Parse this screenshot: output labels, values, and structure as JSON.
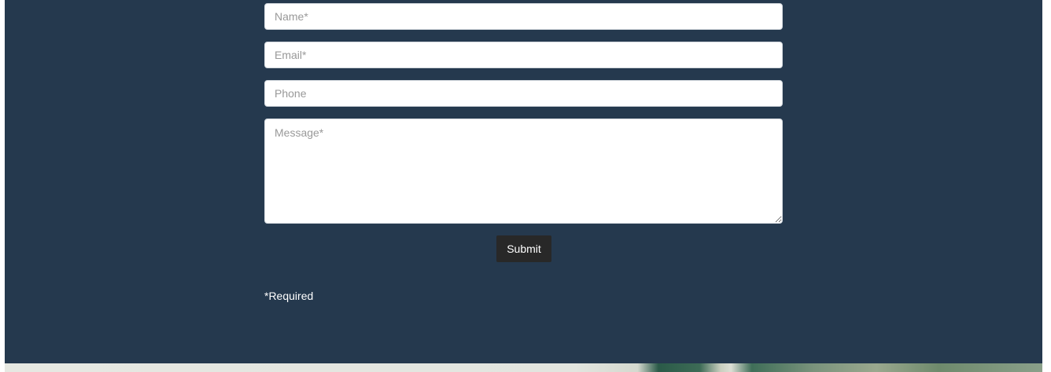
{
  "contact_form": {
    "name_placeholder": "Name*",
    "email_placeholder": "Email*",
    "phone_placeholder": "Phone",
    "message_placeholder": "Message*",
    "submit_label": "Submit",
    "required_note": "*Required"
  },
  "colors": {
    "section_background": "#25394e",
    "button_background": "#282828",
    "field_background": "#ffffff"
  }
}
